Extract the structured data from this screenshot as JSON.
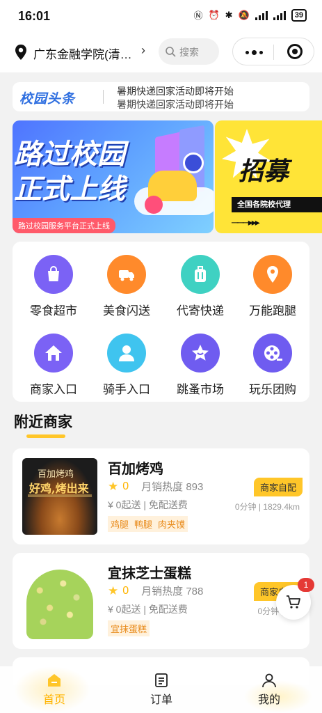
{
  "status_bar": {
    "time": "16:01",
    "battery": "39"
  },
  "header": {
    "location": "广东金融学院(清…",
    "search_placeholder": "搜索"
  },
  "news": {
    "logo": "校园头条",
    "line1": "暑期快递回家活动即将开始",
    "line2": "暑期快递回家活动即将开始"
  },
  "banner": {
    "headline_1": "路过校园",
    "headline_2": "正式上线",
    "pill": "路过校园服务平台正式上线"
  },
  "banner2": {
    "title": "招募",
    "strip": "全国各院校代理"
  },
  "categories": [
    {
      "label": "零食超市",
      "icon": "shopping-bag-icon",
      "color": "#7b62f5"
    },
    {
      "label": "美食闪送",
      "icon": "delivery-truck-icon",
      "color": "#ff8a2b"
    },
    {
      "label": "代寄快递",
      "icon": "suitcase-icon",
      "color": "#3fd1c2"
    },
    {
      "label": "万能跑腿",
      "icon": "location-pin-icon",
      "color": "#ff8a2b"
    },
    {
      "label": "商家入口",
      "icon": "home-icon",
      "color": "#7b62f5"
    },
    {
      "label": "骑手入口",
      "icon": "user-icon",
      "color": "#3fc4ef"
    },
    {
      "label": "跳蚤市场",
      "icon": "star-icon",
      "color": "#6f5cf0"
    },
    {
      "label": "玩乐团购",
      "icon": "film-reel-icon",
      "color": "#6f5cf0"
    }
  ],
  "section": {
    "title": "附近商家"
  },
  "shops": [
    {
      "name": "百加烤鸡",
      "score": "0",
      "sales": "月销热度 893",
      "fee": "¥ 0起送 | 免配送费",
      "tags": [
        "鸡腿",
        "鸭腿",
        "肉夹馍"
      ],
      "badge": "商家自配",
      "distance": "0分钟 | 1829.4km",
      "img_title": "百加烤鸡",
      "img_slogan": "好鸡,烤出来"
    },
    {
      "name": "宜抹芝士蛋糕",
      "score": "0",
      "sales": "月销热度 788",
      "fee": "¥ 0起送 | 免配送费",
      "tags": [
        "宜抹蛋糕"
      ],
      "badge": "商家自配",
      "distance": "0分钟 | 182"
    }
  ],
  "cart": {
    "count": "1"
  },
  "tabs": [
    {
      "label": "首页",
      "icon": "home-icon",
      "active": true
    },
    {
      "label": "订单",
      "icon": "order-list-icon",
      "active": false
    },
    {
      "label": "我的",
      "icon": "profile-icon",
      "active": false
    }
  ],
  "colors": {
    "accent": "#ffc629",
    "brand_blue": "#2f6fe0",
    "tag_orange": "#e88a1a"
  }
}
